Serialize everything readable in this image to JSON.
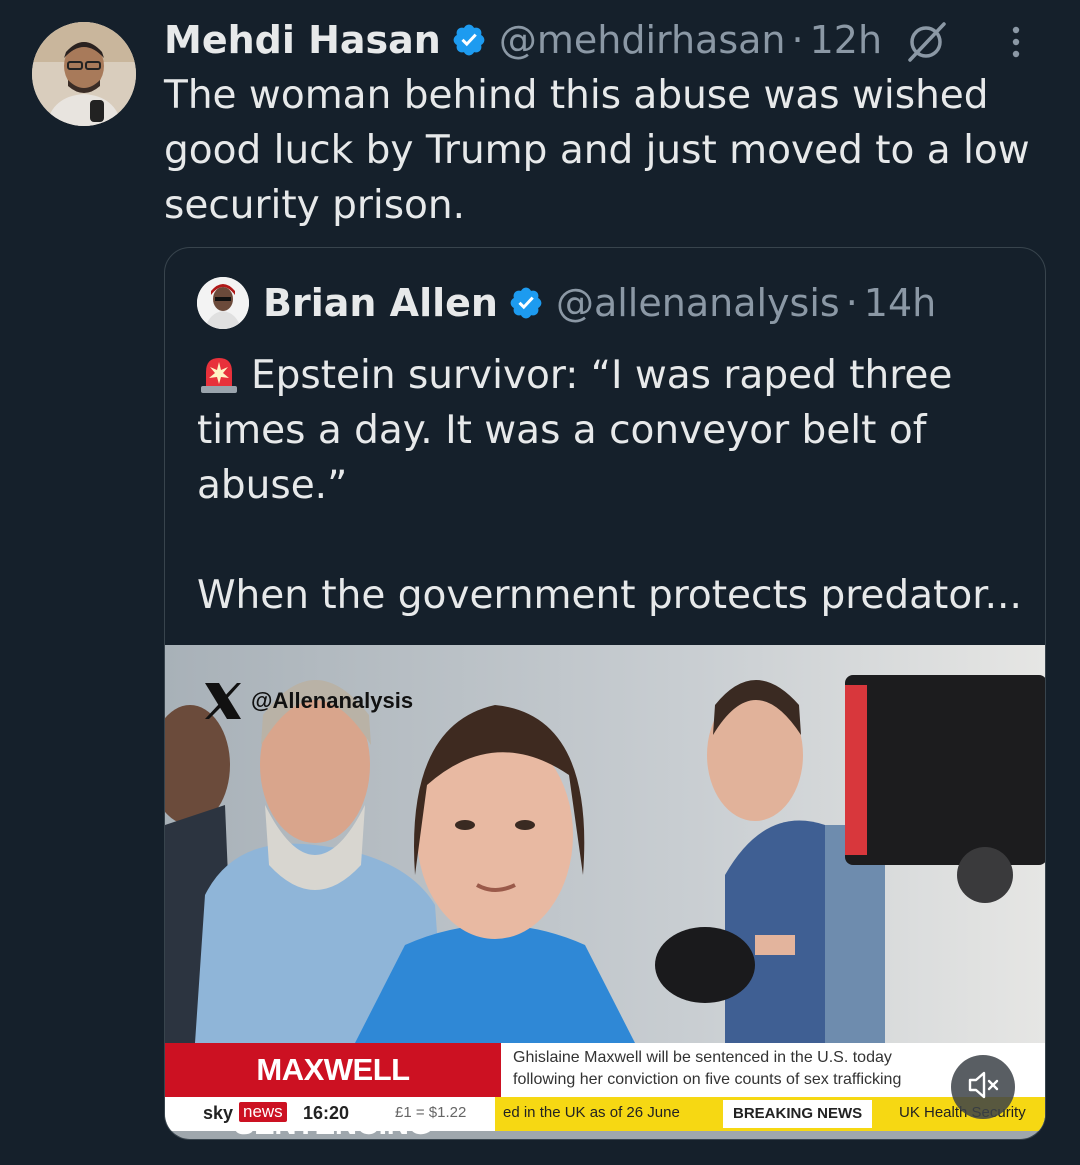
{
  "tweet": {
    "author_name": "Mehdi Hasan",
    "handle": "@mehdirhasan",
    "separator": "·",
    "time": "12h",
    "text": "The woman behind this abuse was wished good luck by Trump and just moved to a low security prison."
  },
  "quote": {
    "author_name": "Brian Allen",
    "handle": "@allenanalysis",
    "separator": "·",
    "time": "14h",
    "text_line1": "Epstein survivor: “I was raped three times a day. It was a conveyor belt of abuse.”",
    "text_line2": "When the government protects predator..."
  },
  "video": {
    "watermark": "@Allenanalysis",
    "strap_title": "MAXWELL SENTENCING",
    "strap_line1": "Ghislaine Maxwell will be sentenced in the U.S. today",
    "strap_line2": "following her conviction on five counts of sex trafficking",
    "ticker_sky": "sky",
    "ticker_news": "news",
    "ticker_time": "16:20",
    "ticker_fx": "£1 = $1.22",
    "ticker_scroll": "ed in the UK as of 26 June",
    "ticker_breaking": "BREAKING NEWS",
    "ticker_uk": "UK Health Security"
  },
  "colors": {
    "background": "#15202b",
    "verified": "#1d9bf0",
    "secondary_text": "#8b98a5",
    "sky_red": "#cc1122",
    "ticker_yellow": "#f6d813"
  },
  "icons": [
    "verified-badge-icon",
    "grok-icon",
    "more-icon",
    "siren-icon",
    "x-logo-icon",
    "mute-icon"
  ]
}
